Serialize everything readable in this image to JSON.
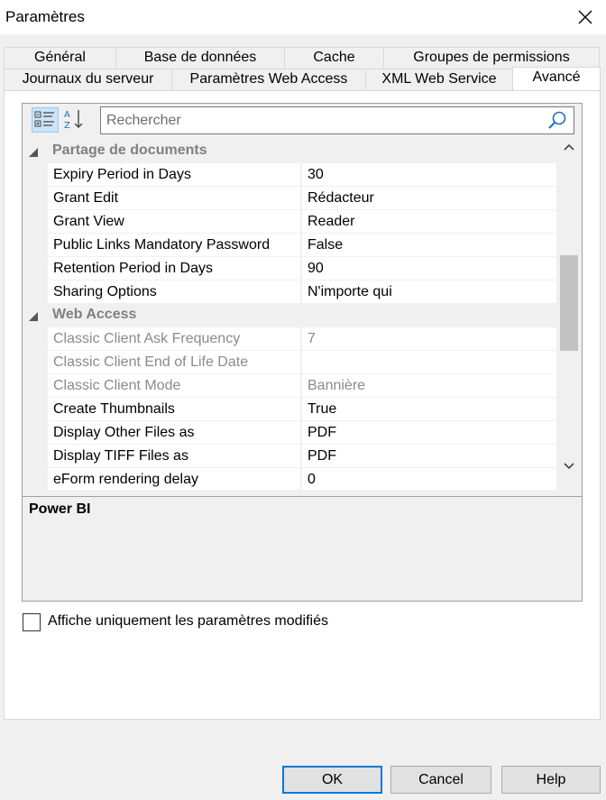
{
  "window": {
    "title": "Paramètres"
  },
  "tabs": {
    "row1": [
      {
        "label": "Général"
      },
      {
        "label": "Base de données"
      },
      {
        "label": "Cache"
      },
      {
        "label": "Groupes de permissions"
      }
    ],
    "row2": [
      {
        "label": "Journaux du serveur"
      },
      {
        "label": "Paramètres Web Access"
      },
      {
        "label": "XML Web Service"
      },
      {
        "label": "Avancé",
        "active": true
      }
    ]
  },
  "toolbar": {
    "categorized_icon": "categorized-view-icon",
    "alphabetical_icon": "sort-alphabetical-icon"
  },
  "search": {
    "placeholder": "Rechercher",
    "value": ""
  },
  "property_grid": {
    "categories": [
      {
        "label": "Partage de documents",
        "properties": [
          {
            "name": "Expiry Period in Days",
            "value": "30"
          },
          {
            "name": "Grant Edit",
            "value": "Rédacteur"
          },
          {
            "name": "Grant View",
            "value": "Reader"
          },
          {
            "name": "Public Links Mandatory Password",
            "value": "False"
          },
          {
            "name": "Retention Period in Days",
            "value": "90"
          },
          {
            "name": "Sharing Options",
            "value": "N'importe qui"
          }
        ]
      },
      {
        "label": "Web Access",
        "properties": [
          {
            "name": "Classic Client Ask Frequency",
            "value": "7",
            "disabled": true
          },
          {
            "name": "Classic Client End of Life Date",
            "value": "",
            "disabled": true
          },
          {
            "name": "Classic Client Mode",
            "value": "Bannière",
            "disabled": true
          },
          {
            "name": "Create Thumbnails",
            "value": "True"
          },
          {
            "name": "Display Other Files as",
            "value": "PDF"
          },
          {
            "name": "Display TIFF Files as",
            "value": "PDF"
          },
          {
            "name": "eForm rendering delay",
            "value": "0"
          }
        ]
      }
    ]
  },
  "description": {
    "title": "Power BI"
  },
  "options": {
    "show_modified_only_label": "Affiche uniquement les paramètres modifiés",
    "show_modified_only_checked": false
  },
  "buttons": {
    "ok": "OK",
    "cancel": "Cancel",
    "help": "Help"
  },
  "colors": {
    "accent": "#0078d7",
    "dialog_bg": "#f0f0f0",
    "disabled_text": "#8a8a8a"
  }
}
